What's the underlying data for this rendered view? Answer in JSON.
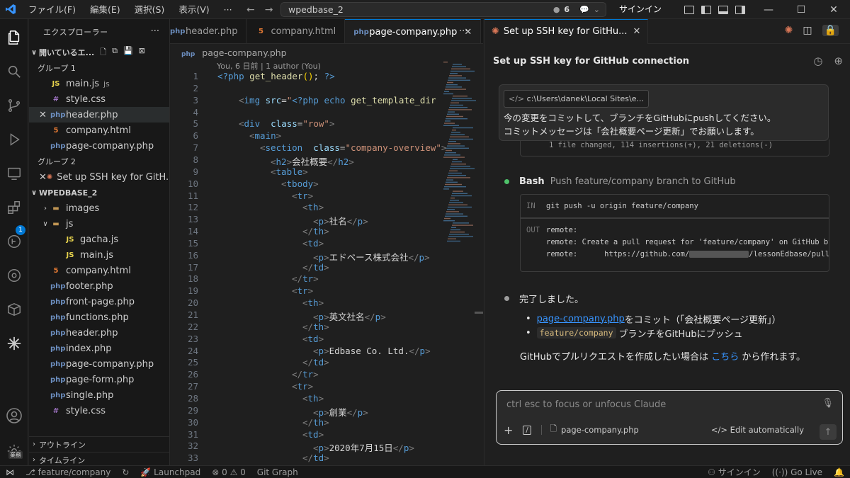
{
  "titlebar": {
    "menus": [
      "ファイル(F)",
      "編集(E)",
      "選択(S)",
      "表示(V)",
      "···"
    ],
    "search": "wpedbase_2",
    "agent_count": "6",
    "signin": "サインイン"
  },
  "sidebar": {
    "title": "エクスプローラー",
    "open_editors_label": "開いているエ...",
    "group1_label": "グループ 1",
    "group1": [
      {
        "name": "main.js",
        "suffix": "js",
        "icon": "js",
        "close": false,
        "selected": false
      },
      {
        "name": "style.css",
        "suffix": "",
        "icon": "css",
        "close": false,
        "selected": false
      },
      {
        "name": "header.php",
        "suffix": "",
        "icon": "php",
        "close": true,
        "selected": true
      },
      {
        "name": "company.html",
        "suffix": "",
        "icon": "html",
        "close": false,
        "selected": false
      },
      {
        "name": "page-company.php",
        "suffix": "",
        "icon": "php",
        "close": false,
        "selected": false
      }
    ],
    "group2_label": "グループ 2",
    "group2": [
      {
        "name": "Set up SSH key for GitH...",
        "icon": "claude",
        "close": true
      }
    ],
    "project_label": "WPEDBASE_2",
    "tree": [
      {
        "name": "images",
        "type": "folder",
        "expanded": false,
        "depth": 0
      },
      {
        "name": "js",
        "type": "folder",
        "expanded": true,
        "depth": 0
      },
      {
        "name": "gacha.js",
        "type": "js",
        "depth": 1
      },
      {
        "name": "main.js",
        "type": "js",
        "depth": 1
      },
      {
        "name": "company.html",
        "type": "html",
        "depth": 0
      },
      {
        "name": "footer.php",
        "type": "php",
        "depth": 0
      },
      {
        "name": "front-page.php",
        "type": "php",
        "depth": 0
      },
      {
        "name": "functions.php",
        "type": "php",
        "depth": 0
      },
      {
        "name": "header.php",
        "type": "php",
        "depth": 0
      },
      {
        "name": "index.php",
        "type": "php",
        "depth": 0
      },
      {
        "name": "page-company.php",
        "type": "php",
        "depth": 0
      },
      {
        "name": "page-form.php",
        "type": "php",
        "depth": 0
      },
      {
        "name": "single.php",
        "type": "php",
        "depth": 0
      },
      {
        "name": "style.css",
        "type": "css",
        "depth": 0
      }
    ],
    "outline_label": "アウトライン",
    "timeline_label": "タイムライン"
  },
  "activity": {
    "badge": "1",
    "account_label": "業務"
  },
  "editor": {
    "tabs": [
      {
        "name": "header.php",
        "icon": "php",
        "active": false
      },
      {
        "name": "company.html",
        "icon": "html",
        "active": false
      },
      {
        "name": "page-company.php",
        "icon": "php",
        "active": true
      }
    ],
    "breadcrumb": "page-company.php",
    "codelens": "You, 6 日前 | 1 author (You)",
    "lines": [
      {
        "n": "1",
        "indent": 0,
        "code": "<?php get_header(); ?>"
      },
      {
        "n": "2",
        "indent": 0,
        "code": ""
      },
      {
        "n": "3",
        "indent": 2,
        "code": "<img src=\"<?php echo get_template_dir"
      },
      {
        "n": "4",
        "indent": 0,
        "code": ""
      },
      {
        "n": "5",
        "indent": 2,
        "code": "<div class=\"row\">"
      },
      {
        "n": "6",
        "indent": 3,
        "code": "<main>"
      },
      {
        "n": "7",
        "indent": 4,
        "code": "<section class=\"company-overview\">"
      },
      {
        "n": "8",
        "indent": 5,
        "code": "<h2>会社概要</h2>"
      },
      {
        "n": "9",
        "indent": 5,
        "code": "<table>"
      },
      {
        "n": "10",
        "indent": 6,
        "code": "<tbody>"
      },
      {
        "n": "11",
        "indent": 7,
        "code": "<tr>"
      },
      {
        "n": "12",
        "indent": 8,
        "code": "<th>"
      },
      {
        "n": "13",
        "indent": 9,
        "code": "<p>社名</p>"
      },
      {
        "n": "14",
        "indent": 8,
        "code": "</th>"
      },
      {
        "n": "15",
        "indent": 8,
        "code": "<td>"
      },
      {
        "n": "16",
        "indent": 9,
        "code": "<p>エドベース株式会社</p>"
      },
      {
        "n": "17",
        "indent": 8,
        "code": "</td>"
      },
      {
        "n": "18",
        "indent": 7,
        "code": "</tr>"
      },
      {
        "n": "19",
        "indent": 7,
        "code": "<tr>"
      },
      {
        "n": "20",
        "indent": 8,
        "code": "<th>"
      },
      {
        "n": "21",
        "indent": 9,
        "code": "<p>英文社名</p>"
      },
      {
        "n": "22",
        "indent": 8,
        "code": "</th>"
      },
      {
        "n": "23",
        "indent": 8,
        "code": "<td>"
      },
      {
        "n": "24",
        "indent": 9,
        "code": "<p>Edbase Co. Ltd.</p>"
      },
      {
        "n": "25",
        "indent": 8,
        "code": "</td>"
      },
      {
        "n": "26",
        "indent": 7,
        "code": "</tr>"
      },
      {
        "n": "27",
        "indent": 7,
        "code": "<tr>"
      },
      {
        "n": "28",
        "indent": 8,
        "code": "<th>"
      },
      {
        "n": "29",
        "indent": 9,
        "code": "<p>創業</p>"
      },
      {
        "n": "30",
        "indent": 8,
        "code": "</th>"
      },
      {
        "n": "31",
        "indent": 8,
        "code": "<td>"
      },
      {
        "n": "32",
        "indent": 9,
        "code": "<p>2020年7月15日</p>"
      },
      {
        "n": "33",
        "indent": 8,
        "code": "</td>"
      }
    ]
  },
  "chat": {
    "tab_title": "Set up SSH key for GitHu...",
    "title": "Set up SSH key for GitHub connection",
    "user_path": "c:\\Users\\danek\\Local Sites\\e...",
    "user_msg_1": "今の変更をコミットして、ブランチをGitHubにpushしてください。",
    "user_msg_2": "コミットメッセージは「会社概要ページ更新」でお願いします。",
    "prev_output": "1 file changed, 114 insertions(+), 21 deletions(-)",
    "bash_label": "Bash",
    "bash_desc": "Push feature/company branch to GitHub",
    "term_in_label": "IN",
    "term_in": "git push -u origin feature/company",
    "term_out_label": "OUT",
    "term_out": [
      "remote:",
      "remote: Create a pull request for 'feature/company' on GitHub by visitin",
      "remote:      https://github.com/"
    ],
    "term_out_tail": "/lessonEdbase/pull/new/fe",
    "done": "完了しました。",
    "bullet1_link": "page-company.php",
    "bullet1_text": " をコミット（「会社概要ページ更新」）",
    "bullet2_code": "feature/company",
    "bullet2_text": "ブランチをGitHubにプッシュ",
    "pr_prefix": "GitHubでプルリクエストを作成したい場合は ",
    "pr_link": "こちら",
    "pr_suffix": " から作れます。",
    "input_placeholder": "ctrl esc to focus or unfocus Claude",
    "attached_file": "page-company.php",
    "edit_mode": "Edit automatically"
  },
  "status": {
    "branch": "feature/company",
    "launchpad": "Launchpad",
    "errors": "0",
    "warnings": "0",
    "git_graph": "Git Graph",
    "signin": "サインイン",
    "golive": "Go Live"
  },
  "colors": {
    "accent": "#0078d4",
    "link": "#3794ff",
    "claude": "#d97757",
    "success": "#4ec26a"
  }
}
